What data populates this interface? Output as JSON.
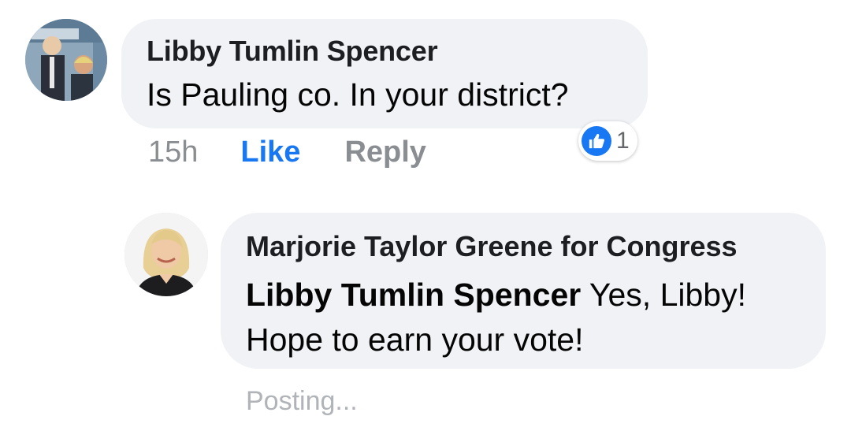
{
  "comments": [
    {
      "author": "Libby Tumlin Spencer",
      "text": "Is Pauling co. In your district?",
      "timestamp": "15h",
      "like_label": "Like",
      "reply_label": "Reply",
      "reaction_count": "1",
      "reaction_icon": "thumbs-up-icon"
    },
    {
      "author": "Marjorie Taylor Greene for Congress",
      "mention": "Libby Tumlin Spencer",
      "text_line1": " Yes, Libby!",
      "text_line2": "Hope to earn your vote!",
      "status": "Posting..."
    }
  ],
  "colors": {
    "bubble": "#f0f2f5",
    "like_blue": "#1877f2",
    "meta_gray": "#8a8d91",
    "posting_gray": "#b0b3b8"
  }
}
